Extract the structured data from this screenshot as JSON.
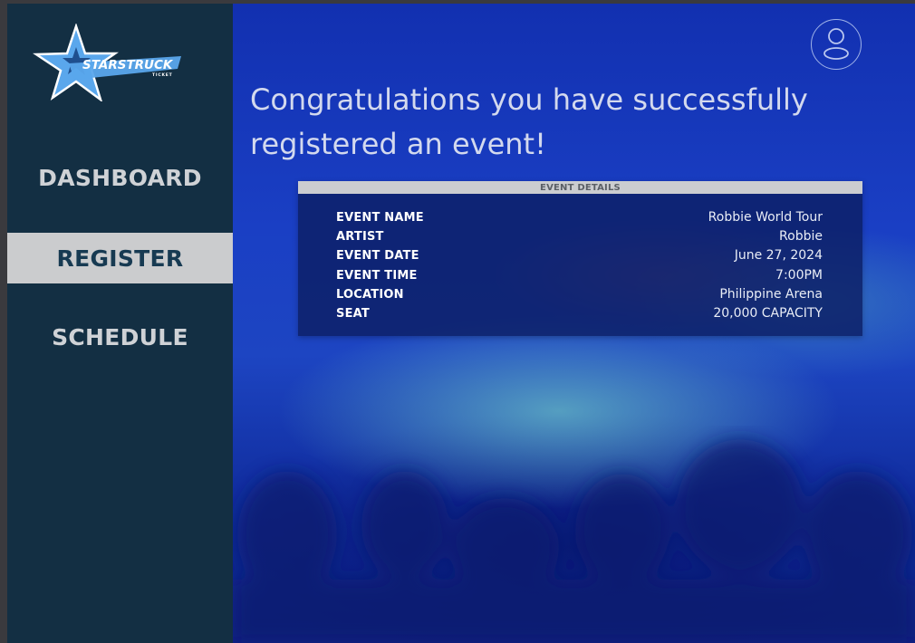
{
  "brand": {
    "name": "STARSTRUCK",
    "tagline": "TICKET",
    "colors": {
      "star": "#5aa7ec",
      "sidebar": "#132f43"
    }
  },
  "sidebar": {
    "items": [
      {
        "label": "DASHBOARD",
        "active": false
      },
      {
        "label": "REGISTER",
        "active": true
      },
      {
        "label": "SCHEDULE",
        "active": false
      }
    ]
  },
  "header": {
    "profile_icon": "user-icon"
  },
  "main": {
    "headline": "Congratulations you have successfully registered an event!",
    "details": {
      "title": "EVENT DETAILS",
      "rows": [
        {
          "label": "EVENT NAME",
          "value": "Robbie World Tour"
        },
        {
          "label": "ARTIST",
          "value": "Robbie"
        },
        {
          "label": "EVENT DATE",
          "value": "June 27, 2024"
        },
        {
          "label": "EVENT TIME",
          "value": "7:00PM"
        },
        {
          "label": "LOCATION",
          "value": "Philippine Arena"
        },
        {
          "label": "SEAT",
          "value": "20,000 CAPACITY"
        }
      ]
    }
  }
}
